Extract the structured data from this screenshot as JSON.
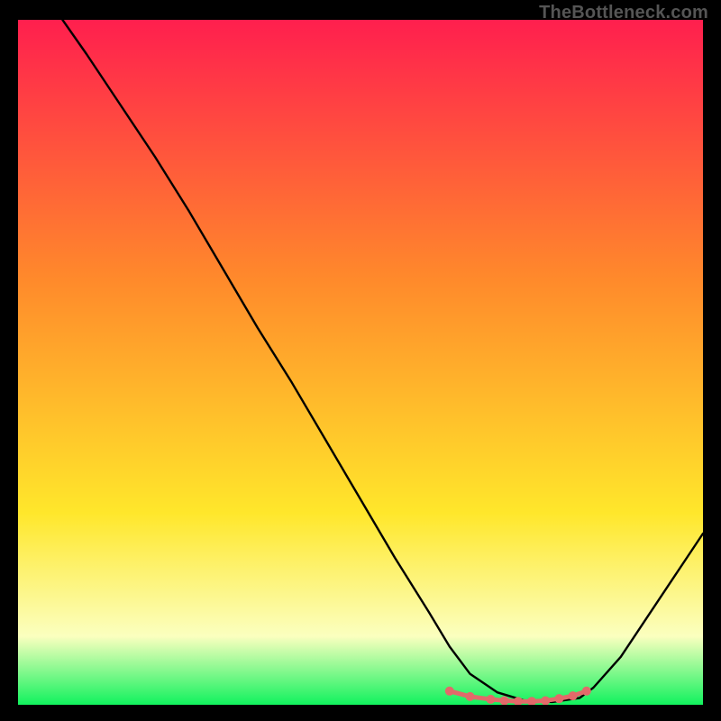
{
  "watermark": "TheBottleneck.com",
  "chart_data": {
    "type": "line",
    "title": "",
    "xlabel": "",
    "ylabel": "",
    "xlim": [
      0,
      100
    ],
    "ylim": [
      0,
      100
    ],
    "grid": false,
    "legend": false,
    "gradient": {
      "top_color": "#ff1f4e",
      "mid1_color": "#ff8a2b",
      "mid2_color": "#ffe72b",
      "band_color": "#fbffbf",
      "bottom_color": "#11f25e"
    },
    "series": [
      {
        "name": "curve",
        "stroke": "#000000",
        "x": [
          6.5,
          10,
          15,
          20,
          25,
          30,
          35,
          40,
          45,
          50,
          55,
          60,
          63,
          66,
          70,
          74,
          78,
          82,
          84,
          88,
          92,
          96,
          100
        ],
        "y": [
          100,
          95,
          87.5,
          80,
          72,
          63.5,
          55,
          47,
          38.5,
          30,
          21.5,
          13.5,
          8.5,
          4.5,
          1.8,
          0.6,
          0.4,
          1.0,
          2.5,
          7,
          13,
          19,
          25
        ]
      },
      {
        "name": "basin-markers",
        "stroke": "#e26a6a",
        "marker_color": "#e26a6a",
        "x": [
          63,
          66,
          69,
          71,
          73,
          75,
          77,
          79,
          81,
          83
        ],
        "y": [
          2.0,
          1.2,
          0.8,
          0.6,
          0.5,
          0.5,
          0.6,
          0.9,
          1.3,
          2.0
        ]
      }
    ]
  }
}
